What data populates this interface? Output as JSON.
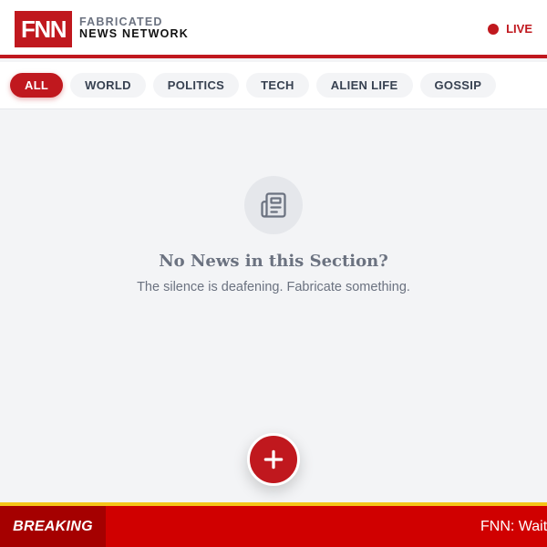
{
  "header": {
    "logo": "FNN",
    "brand_line1": "FABRICATED",
    "brand_line2": "NEWS NETWORK",
    "live_label": "LIVE"
  },
  "tabs": [
    {
      "label": "ALL",
      "active": true
    },
    {
      "label": "WORLD",
      "active": false
    },
    {
      "label": "POLITICS",
      "active": false
    },
    {
      "label": "TECH",
      "active": false
    },
    {
      "label": "ALIEN LIFE",
      "active": false
    },
    {
      "label": "GOSSIP",
      "active": false
    }
  ],
  "empty_state": {
    "icon": "newspaper-icon",
    "title": "No News in this Section?",
    "subtitle": "The silence is deafening. Fabricate something."
  },
  "fab": {
    "icon": "plus-icon"
  },
  "ticker": {
    "label": "BREAKING",
    "text": "FNN: Wait"
  },
  "colors": {
    "brand_red": "#c0181e",
    "ticker_red": "#d00000",
    "ticker_label_red": "#a50000",
    "ticker_border": "#f5c518",
    "background": "#f3f4f6"
  }
}
